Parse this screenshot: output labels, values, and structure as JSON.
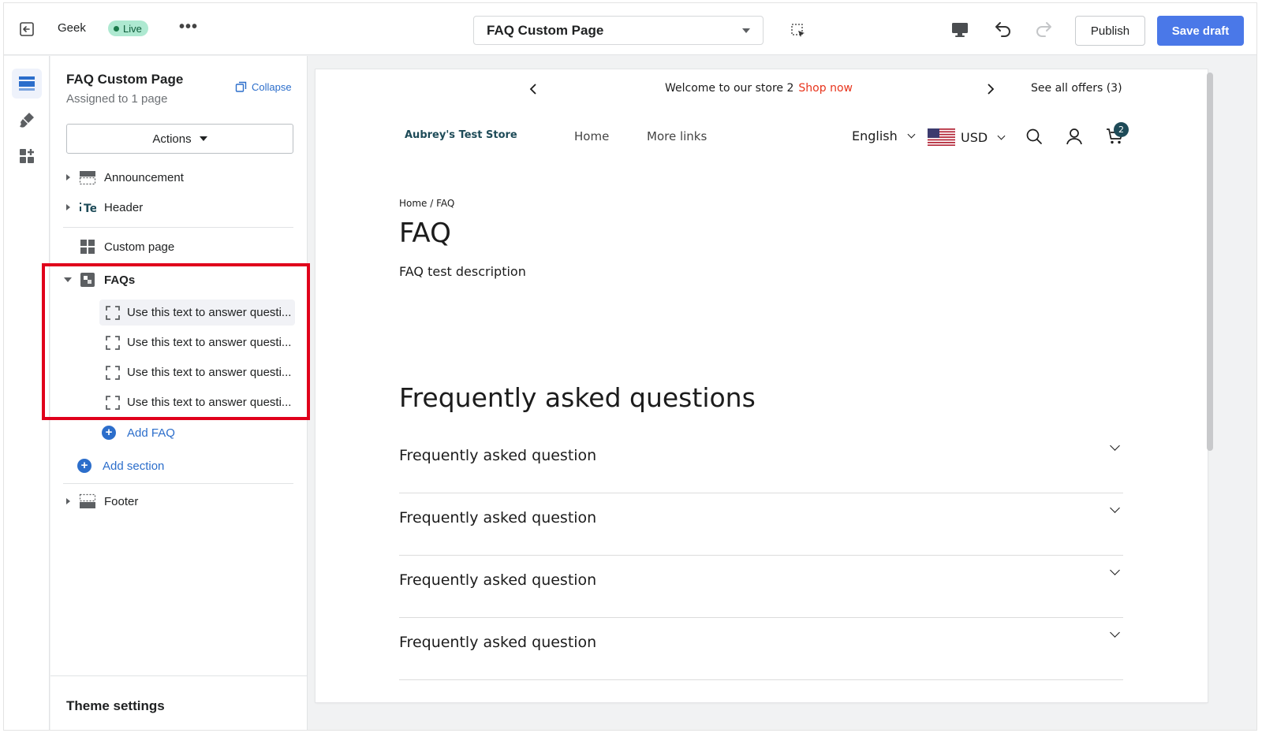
{
  "topbar": {
    "store_name": "Geek",
    "live_label": "Live",
    "more_label": "•••",
    "page_selector": "FAQ Custom Page",
    "publish_label": "Publish",
    "save_label": "Save draft",
    "accent_color": "#4a78e8"
  },
  "rail": {
    "items": [
      {
        "icon": "sections-icon",
        "active": true
      },
      {
        "icon": "brush-icon",
        "active": false
      },
      {
        "icon": "apps-icon",
        "active": false
      }
    ]
  },
  "sidebar": {
    "title": "FAQ Custom Page",
    "subtitle": "Assigned to 1 page",
    "collapse_label": "Collapse",
    "actions_label": "Actions",
    "sections": {
      "announcement": "Announcement",
      "header": "Header",
      "custom_page": "Custom page",
      "faqs": "FAQs",
      "footer": "Footer"
    },
    "faq_items": [
      "Use this text to answer questi...",
      "Use this text to answer questi...",
      "Use this text to answer questi...",
      "Use this text to answer questi..."
    ],
    "add_faq_label": "Add FAQ",
    "add_section_label": "Add section",
    "theme_settings_label": "Theme settings",
    "highlight_color": "#e0001b"
  },
  "preview": {
    "announcement_text": "Welcome to our store 2",
    "announcement_link": "Shop now",
    "offers_label": "See all offers (3)",
    "logo_text": "Aubrey's Test Store",
    "nav_home": "Home",
    "nav_more": "More links",
    "language": "English",
    "currency": "USD",
    "cart_count": "2",
    "breadcrumb": "Home / FAQ",
    "page_title": "FAQ",
    "page_description": "FAQ test description",
    "faq_heading": "Frequently asked questions",
    "questions": [
      "Frequently asked question",
      "Frequently asked question",
      "Frequently asked question",
      "Frequently asked question"
    ]
  }
}
